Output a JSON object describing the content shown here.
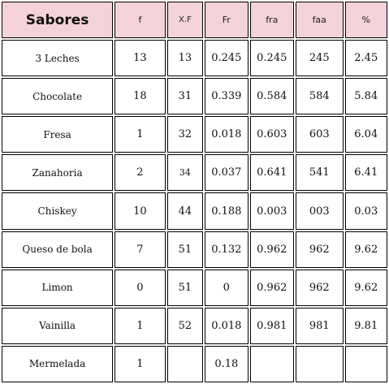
{
  "colors": {
    "header_bg": "#f3d3d9",
    "border": "#000000",
    "background": "#ffffff"
  },
  "table": {
    "headers": [
      "Sabores",
      "f",
      "X.F",
      "Fr",
      "fra",
      "faa",
      "%"
    ],
    "rows": [
      [
        "3 Leches",
        "13",
        "13",
        "0.245",
        "0.245",
        "245",
        "2.45"
      ],
      [
        "Chocolate",
        "18",
        "31",
        "0.339",
        "0.584",
        "584",
        "5.84"
      ],
      [
        "Fresa",
        "1",
        "32",
        "0.018",
        "0.603",
        "603",
        "6.04"
      ],
      [
        "Zanahoria",
        "2",
        "34",
        "0.037",
        "0.641",
        "541",
        "6.41"
      ],
      [
        "Chiskey",
        "10",
        "44",
        "0.188",
        "0.003",
        "003",
        "0.03"
      ],
      [
        "Queso de bola",
        "7",
        "51",
        "0.132",
        "0.962",
        "962",
        "9.62"
      ],
      [
        "Limon",
        "0",
        "51",
        "0",
        "0.962",
        "962",
        "9.62"
      ],
      [
        "Vainilla",
        "1",
        "52",
        "0.018",
        "0.981",
        "981",
        "9.81"
      ],
      [
        "Mermelada",
        "1",
        "",
        "0.18",
        "",
        "",
        ""
      ]
    ]
  }
}
